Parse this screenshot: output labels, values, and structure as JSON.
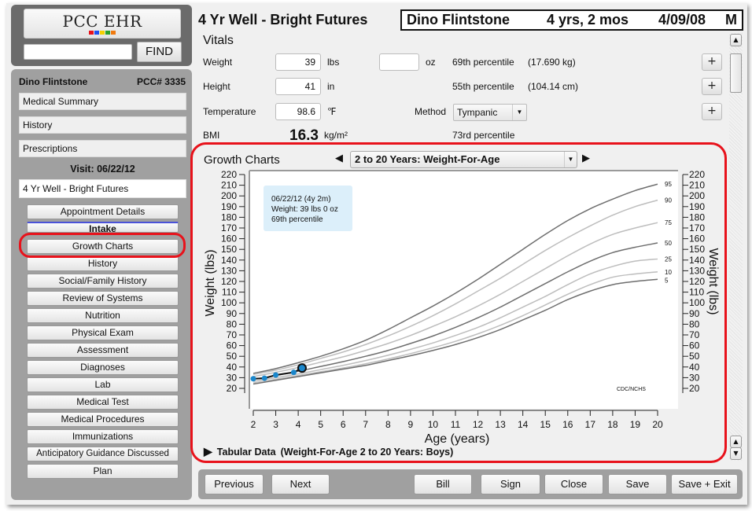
{
  "app": {
    "logo_text": "PCC EHR",
    "logo_colors": [
      "#e8111a",
      "#1f4ff0",
      "#f5d000",
      "#2aa12a",
      "#f07a10"
    ],
    "find_input_value": "",
    "find_label": "FIND"
  },
  "sidebar": {
    "patient_name": "Dino Flintstone",
    "pcc_number": "PCC# 3335",
    "links": [
      {
        "label": "Medical Summary"
      },
      {
        "label": "History"
      },
      {
        "label": "Prescriptions"
      }
    ],
    "visit_label": "Visit: 06/22/12",
    "visit_name": "4 Yr Well - Bright Futures",
    "sections": [
      {
        "label": "Appointment Details"
      },
      {
        "label": "Intake"
      },
      {
        "label": "Growth Charts"
      },
      {
        "label": "History"
      },
      {
        "label": "Social/Family History"
      },
      {
        "label": "Review of Systems"
      },
      {
        "label": "Nutrition"
      },
      {
        "label": "Physical Exam"
      },
      {
        "label": "Assessment"
      },
      {
        "label": "Diagnoses"
      },
      {
        "label": "Lab"
      },
      {
        "label": "Medical Test"
      },
      {
        "label": "Medical Procedures"
      },
      {
        "label": "Immunizations"
      },
      {
        "label": "Anticipatory Guidance Discussed"
      },
      {
        "label": "Plan"
      }
    ],
    "highlight_color": "#e8121b"
  },
  "header": {
    "visit_title": "4 Yr Well - Bright Futures",
    "banner_name": "Dino Flintstone",
    "banner_age": "4 yrs, 2 mos",
    "banner_dob": "4/09/08",
    "banner_sex": "M"
  },
  "vitals": {
    "title": "Vitals",
    "weight": {
      "label": "Weight",
      "lbs": "39",
      "lbs_unit": "lbs",
      "oz": "",
      "oz_unit": "oz",
      "percentile": "69th percentile",
      "metric": "(17.690 kg)"
    },
    "height": {
      "label": "Height",
      "value": "41",
      "unit": "in",
      "percentile": "55th percentile",
      "metric": "(104.14 cm)"
    },
    "temperature": {
      "label": "Temperature",
      "value": "98.6",
      "unit": "℉",
      "method_label": "Method",
      "method_value": "Tympanic"
    },
    "bmi": {
      "label": "BMI",
      "value": "16.3",
      "unit": "kg/m²",
      "percentile": "73rd percentile"
    },
    "plus_label": "+"
  },
  "growth": {
    "title": "Growth Charts",
    "selected_chart": "2 to 20 Years: Weight-For-Age",
    "tabular_label": "Tabular Data",
    "tabular_desc": "(Weight-For-Age 2 to 20 Years: Boys)"
  },
  "chart_data": {
    "type": "line",
    "title": "2 to 20 Years: Weight-For-Age",
    "xlabel": "Age (years)",
    "ylabel": "Weight (lbs)",
    "ylabel_right": "Weight (lbs)",
    "xlim": [
      2,
      20
    ],
    "ylim": [
      20,
      220
    ],
    "x_ticks": [
      2,
      3,
      4,
      5,
      6,
      7,
      8,
      9,
      10,
      11,
      12,
      13,
      14,
      15,
      16,
      17,
      18,
      19,
      20
    ],
    "y_ticks": [
      20,
      30,
      40,
      50,
      60,
      70,
      80,
      90,
      100,
      110,
      120,
      130,
      140,
      150,
      160,
      170,
      180,
      190,
      200,
      210,
      220
    ],
    "source_label": "CDC/NCHS",
    "x": [
      2,
      3,
      4,
      5,
      6,
      7,
      8,
      9,
      10,
      11,
      12,
      13,
      14,
      15,
      16,
      17,
      18,
      19,
      20
    ],
    "series": [
      {
        "name": "95",
        "values": [
          34,
          38.5,
          44,
          50,
          57,
          65,
          75,
          86,
          97,
          109,
          122,
          136,
          150,
          164,
          177,
          188,
          197,
          205,
          211
        ],
        "shade": "dark"
      },
      {
        "name": "90",
        "values": [
          33,
          37,
          42,
          48,
          54,
          61,
          69,
          78,
          88,
          99,
          111,
          123,
          136,
          149,
          161,
          172,
          182,
          190,
          196
        ],
        "shade": "light"
      },
      {
        "name": "75",
        "values": [
          31,
          35,
          39.5,
          44.5,
          49.5,
          55.5,
          62,
          69.5,
          78,
          87,
          97,
          108,
          120,
          132,
          144,
          155,
          164,
          170,
          175
        ],
        "shade": "light"
      },
      {
        "name": "50",
        "values": [
          28.5,
          32,
          36,
          40.5,
          45,
          50,
          55.5,
          62,
          69,
          77,
          86,
          96,
          107,
          118,
          129,
          139,
          147,
          152,
          156
        ],
        "shade": "dark"
      },
      {
        "name": "25",
        "values": [
          26.5,
          30,
          33.5,
          37.5,
          41.5,
          46,
          51,
          56.5,
          62.5,
          69.5,
          77,
          86,
          96,
          106,
          117,
          127,
          134,
          139,
          141
        ],
        "shade": "light"
      },
      {
        "name": "10",
        "values": [
          25,
          28.5,
          32,
          35.5,
          39,
          43,
          47.5,
          52.5,
          58,
          64,
          71,
          79,
          88,
          98,
          108,
          117,
          124,
          127,
          129
        ],
        "shade": "light"
      },
      {
        "name": "5",
        "values": [
          24,
          27.5,
          31,
          34.5,
          38,
          41.5,
          46,
          50.5,
          55.5,
          61,
          67.5,
          75,
          84,
          93,
          103,
          111,
          117,
          120,
          122
        ],
        "shade": "dark"
      }
    ],
    "patient_points": [
      {
        "age": 2.0,
        "weight": 29
      },
      {
        "age": 2.5,
        "weight": 29.5
      },
      {
        "age": 3.0,
        "weight": 32.5
      },
      {
        "age": 3.8,
        "weight": 35
      },
      {
        "age": 4.17,
        "weight": 39
      }
    ],
    "tooltip": {
      "line1": "06/22/12 (4y 2m)",
      "line2": "Weight: 39 lbs 0 oz",
      "line3": "69th percentile"
    },
    "point_color": "#1a87cc",
    "tooltip_bg": "#dceffa"
  },
  "footer": {
    "previous": "Previous",
    "next": "Next",
    "bill": "Bill",
    "sign": "Sign",
    "close": "Close",
    "save": "Save",
    "save_exit": "Save + Exit"
  }
}
